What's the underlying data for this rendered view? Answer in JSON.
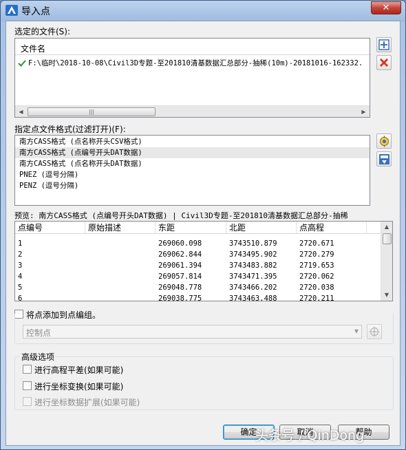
{
  "window": {
    "title": "导入点",
    "close_glyph": "✕"
  },
  "files": {
    "section_label": "选定的文件(S):",
    "column_header": "文件名",
    "items": [
      {
        "path": "F:\\临时\\2018-10-08\\Civil3D专题-至201810清基数据汇总部分-抽稀(10m)-20181016-162332.",
        "status": "checked"
      }
    ],
    "scroll_left": "◀",
    "scroll_right": "▶",
    "thumb_grip": "|||"
  },
  "formats": {
    "section_label": "指定点文件格式(过滤打开)(F):",
    "items": [
      "南方CASS格式 (点名称开头CSV格式)",
      "南方CASS格式 (点编号开头DAT数据)",
      "南方CASS格式 (点名称开头DAT数据)",
      "PNEZ (逗号分隔)",
      "PENZ (逗号分隔)"
    ],
    "selected_index": 1
  },
  "preview": {
    "label": "预览: 南方CASS格式 (点编号开头DAT数据) | Civil3D专题-至201810清基数据汇总部分-抽稀",
    "columns": [
      "点编号",
      "原始描述",
      "东距",
      "北距",
      "点高程"
    ],
    "rows": [
      [
        "1",
        "",
        "269060.098",
        "3743510.879",
        "2720.671"
      ],
      [
        "2",
        "",
        "269062.844",
        "3743495.902",
        "2720.279"
      ],
      [
        "3",
        "",
        "269061.394",
        "3743483.882",
        "2719.653"
      ],
      [
        "4",
        "",
        "269057.814",
        "3743471.395",
        "2720.062"
      ],
      [
        "5",
        "",
        "269048.778",
        "3743466.202",
        "2720.038"
      ],
      [
        "6",
        "",
        "269038.775",
        "3743463.488",
        "2720.211"
      ]
    ],
    "scroll_up": "▲",
    "scroll_down": "▼"
  },
  "add_to_group": {
    "label": "将点添加到点编组。",
    "checked": false
  },
  "point_group": {
    "value": "控制点",
    "arrow": "▾"
  },
  "advanced": {
    "title": "高级选项",
    "options": [
      {
        "label": "进行高程平差(如果可能)",
        "enabled": true
      },
      {
        "label": "进行坐标变换(如果可能)",
        "enabled": true
      },
      {
        "label": "进行坐标数据扩展(如果可能)",
        "enabled": false
      }
    ]
  },
  "buttons": {
    "ok": "确定",
    "cancel": "取消",
    "help": "帮助"
  },
  "watermark": "头条号 / QinDong",
  "colors": {
    "check_green": "#2f8f2f",
    "remove_red": "#d23a2a",
    "selection": "#e8e8e8",
    "disabled_text": "#8c8c8c"
  }
}
